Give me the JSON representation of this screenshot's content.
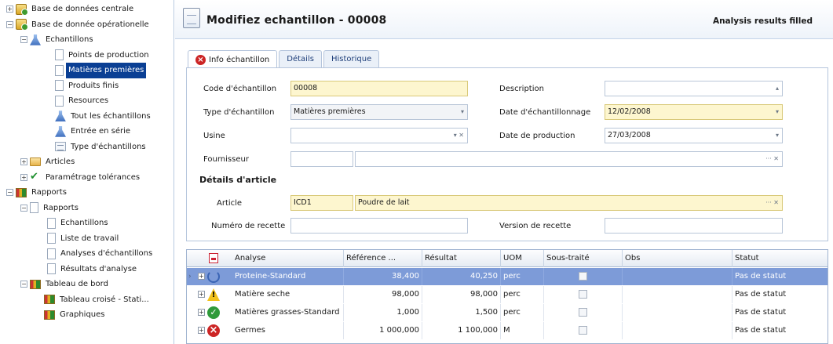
{
  "tree": {
    "items": [
      {
        "label": "Base de données centrale",
        "icon": "database-icon"
      },
      {
        "label": "Base de donnée opérationelle",
        "icon": "database-icon"
      },
      {
        "label": "Echantillons",
        "icon": "flask-icon"
      },
      {
        "label": "Points de production",
        "icon": "document-icon"
      },
      {
        "label": "Matières premières",
        "icon": "document-icon"
      },
      {
        "label": "Produits finis",
        "icon": "document-icon"
      },
      {
        "label": "Resources",
        "icon": "document-icon"
      },
      {
        "label": "Tout les échantillons",
        "icon": "flask-icon"
      },
      {
        "label": "Entrée en série",
        "icon": "flask-icon"
      },
      {
        "label": "Type d'échantillons",
        "icon": "list-icon"
      },
      {
        "label": "Articles",
        "icon": "folder-icon"
      },
      {
        "label": "Paramétrage tolérances",
        "icon": "checkmark-icon"
      },
      {
        "label": "Rapports",
        "icon": "chart-icon"
      },
      {
        "label": "Rapports",
        "icon": "document-icon"
      },
      {
        "label": "Echantillons",
        "icon": "document-icon"
      },
      {
        "label": "Liste de travail",
        "icon": "document-icon"
      },
      {
        "label": "Analyses d'échantillons",
        "icon": "document-icon"
      },
      {
        "label": "Résultats d'analyse",
        "icon": "document-icon"
      },
      {
        "label": "Tableau de bord",
        "icon": "chart-icon"
      },
      {
        "label": "Tableau croisé - Stati...",
        "icon": "chart-icon"
      },
      {
        "label": "Graphiques",
        "icon": "chart-icon"
      }
    ],
    "selected_label": "Matières premières"
  },
  "header": {
    "title": "Modifiez echantillon - 00008",
    "status": "Analysis results filled"
  },
  "tabs": [
    {
      "label": "Info échantillon",
      "active": true
    },
    {
      "label": "Détails",
      "active": false
    },
    {
      "label": "Historique",
      "active": false
    }
  ],
  "form": {
    "code_label": "Code d'échantillon",
    "code_value": "00008",
    "type_label": "Type d'échantillon",
    "type_value": "Matières premières",
    "usine_label": "Usine",
    "usine_value": "",
    "fournisseur_label": "Fournisseur",
    "fournisseur_value": "",
    "description_label": "Description",
    "description_value": "",
    "date_echantillonnage_label": "Date d'échantillonnage",
    "date_echantillonnage_value": "12/02/2008",
    "date_production_label": "Date de production",
    "date_production_value": "27/03/2008",
    "details_article_title": "Détails d'article",
    "article_label": "Article",
    "article_code": "ICD1",
    "article_name": "Poudre de lait",
    "numero_recette_label": "Numéro de recette",
    "numero_recette_value": "",
    "version_recette_label": "Version de recette",
    "version_recette_value": ""
  },
  "grid": {
    "columns": [
      "Analyse",
      "Référence ...",
      "Résultat",
      "UOM",
      "Sous-traité",
      "Obs",
      "Statut"
    ],
    "rows": [
      {
        "status_icon": "running-icon",
        "analyse": "Proteine-Standard",
        "reference": "38,400",
        "resultat": "40,250",
        "uom": "perc",
        "statut": "Pas de statut",
        "selected": true
      },
      {
        "status_icon": "warning-icon",
        "analyse": "Matière seche",
        "reference": "98,000",
        "resultat": "98,000",
        "uom": "perc",
        "statut": "Pas de statut",
        "selected": false
      },
      {
        "status_icon": "ok-icon",
        "analyse": "Matières grasses-Standard",
        "reference": "1,000",
        "resultat": "1,500",
        "uom": "perc",
        "statut": "Pas de statut",
        "selected": false
      },
      {
        "status_icon": "error-icon",
        "analyse": "Germes",
        "reference": "1 000,000",
        "resultat": "1 100,000",
        "uom": "M",
        "statut": "Pas de statut",
        "selected": false
      }
    ]
  }
}
